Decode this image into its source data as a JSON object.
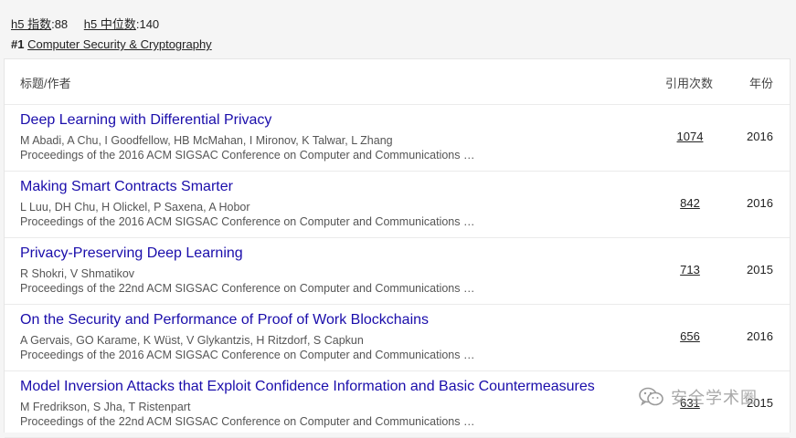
{
  "stats": {
    "h5_index_label": "h5 指数",
    "h5_index_value": ":88",
    "h5_median_label": "h5 中位数",
    "h5_median_value": ":140"
  },
  "category": {
    "rank": "#1",
    "name": "Computer Security & Cryptography"
  },
  "table": {
    "headers": {
      "title_author": "标题/作者",
      "citations": "引用次数",
      "year": "年份"
    },
    "rows": [
      {
        "title": "Deep Learning with Differential Privacy",
        "authors": "M Abadi, A Chu, I Goodfellow, HB McMahan, I Mironov, K Talwar, L Zhang",
        "venue": "Proceedings of the 2016 ACM SIGSAC Conference on Computer and Communications …",
        "citations": "1074",
        "year": "2016"
      },
      {
        "title": "Making Smart Contracts Smarter",
        "authors": "L Luu, DH Chu, H Olickel, P Saxena, A Hobor",
        "venue": "Proceedings of the 2016 ACM SIGSAC Conference on Computer and Communications …",
        "citations": "842",
        "year": "2016"
      },
      {
        "title": "Privacy-Preserving Deep Learning",
        "authors": "R Shokri, V Shmatikov",
        "venue": "Proceedings of the 22nd ACM SIGSAC Conference on Computer and Communications …",
        "citations": "713",
        "year": "2015"
      },
      {
        "title": "On the Security and Performance of Proof of Work Blockchains",
        "authors": "A Gervais, GO Karame, K Wüst, V Glykantzis, H Ritzdorf, S Capkun",
        "venue": "Proceedings of the 2016 ACM SIGSAC Conference on Computer and Communications …",
        "citations": "656",
        "year": "2016"
      },
      {
        "title": "Model Inversion Attacks that Exploit Confidence Information and Basic Countermeasures",
        "authors": "M Fredrikson, S Jha, T Ristenpart",
        "venue": "Proceedings of the 22nd ACM SIGSAC Conference on Computer and Communications …",
        "citations": "631",
        "year": "2015"
      }
    ]
  },
  "watermark": {
    "text": "安全学术圈",
    "icon": "wechat-icon"
  },
  "colors": {
    "link": "#1a0dab",
    "background": "#f5f5f5"
  }
}
